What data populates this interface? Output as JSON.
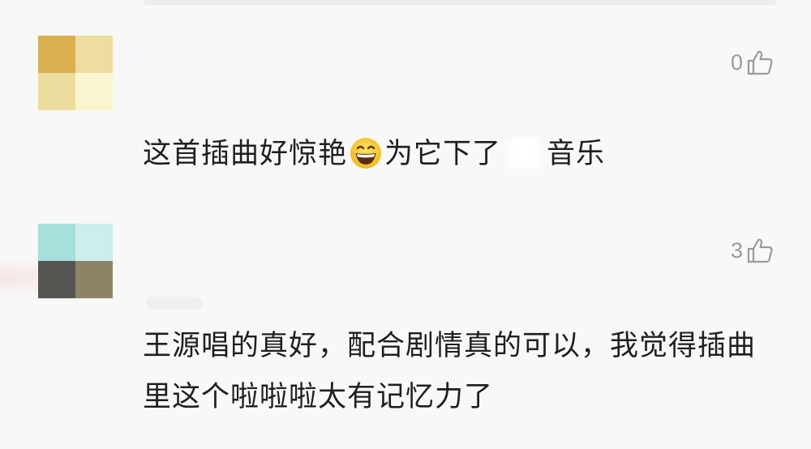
{
  "colors": {
    "background": "#f8f8f8",
    "text": "#1f1f1f",
    "like_count": "#9a9a9a"
  },
  "comments": [
    {
      "avatar_colors": [
        "#d9b04f",
        "#f0dba0",
        "#ecdd9f",
        "#f9f5cf"
      ],
      "like_count": "0",
      "like_icon": "thumbs-up-outline-icon",
      "text_before_emoji": "这首插曲好惊艳",
      "emoji_icon": "grinning-face-with-smiling-eyes-icon",
      "text_after_emoji": "为它下了",
      "text_end": "音乐"
    },
    {
      "avatar_colors": [
        "#a6dfdb",
        "#cdeeea",
        "#555552",
        "#8d8468"
      ],
      "like_count": "3",
      "like_icon": "thumbs-up-outline-icon",
      "text": "王源唱的真好，配合剧情真的可以，我觉得插曲里这个啦啦啦太有记忆力了"
    }
  ]
}
